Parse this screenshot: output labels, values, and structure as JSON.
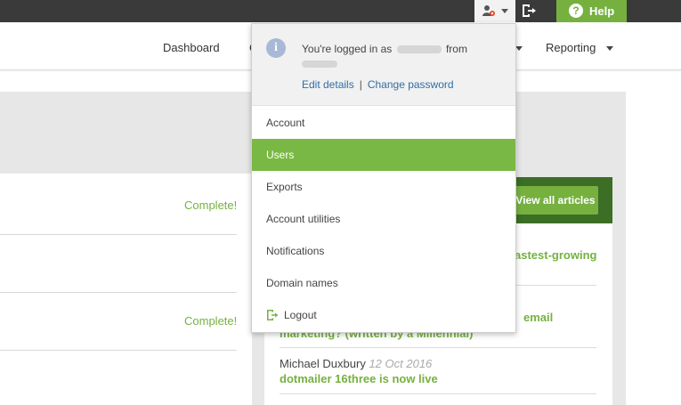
{
  "topbar": {
    "user_menu_icon": "user-settings-icon",
    "logout_icon": "logout-icon",
    "help_label": "Help",
    "help_icon": "question-icon"
  },
  "nav": {
    "dashboard": "Dashboard",
    "partial_item": "C",
    "reporting": "Reporting"
  },
  "content": {
    "complete_1": "Complete!",
    "complete_2": "Complete!",
    "view_all_label": "View all articles",
    "article_1_partial": "astest-growing",
    "article_2_partial_a": "email",
    "article_2_partial_b": "marketing? (written by a Millennial)",
    "article_3_author": "Michael Duxbury",
    "article_3_date": "12 Oct 2016",
    "article_3_title": "dotmailer 16three is now live"
  },
  "dropdown": {
    "info_prefix": "You're logged in as",
    "info_suffix": "from",
    "edit_details": "Edit details",
    "separator": "|",
    "change_password": "Change password",
    "items": [
      {
        "label": "Account",
        "active": false
      },
      {
        "label": "Users",
        "active": true
      },
      {
        "label": "Exports",
        "active": false
      },
      {
        "label": "Account utilities",
        "active": false
      },
      {
        "label": "Notifications",
        "active": false
      },
      {
        "label": "Domain names",
        "active": false
      }
    ],
    "logout_label": "Logout"
  },
  "colors": {
    "brand_green": "#76b140",
    "active_green": "#7ab845",
    "dark_green": "#3c6e25",
    "link_blue": "#2f6ea6",
    "topbar": "#3a3a3a"
  }
}
